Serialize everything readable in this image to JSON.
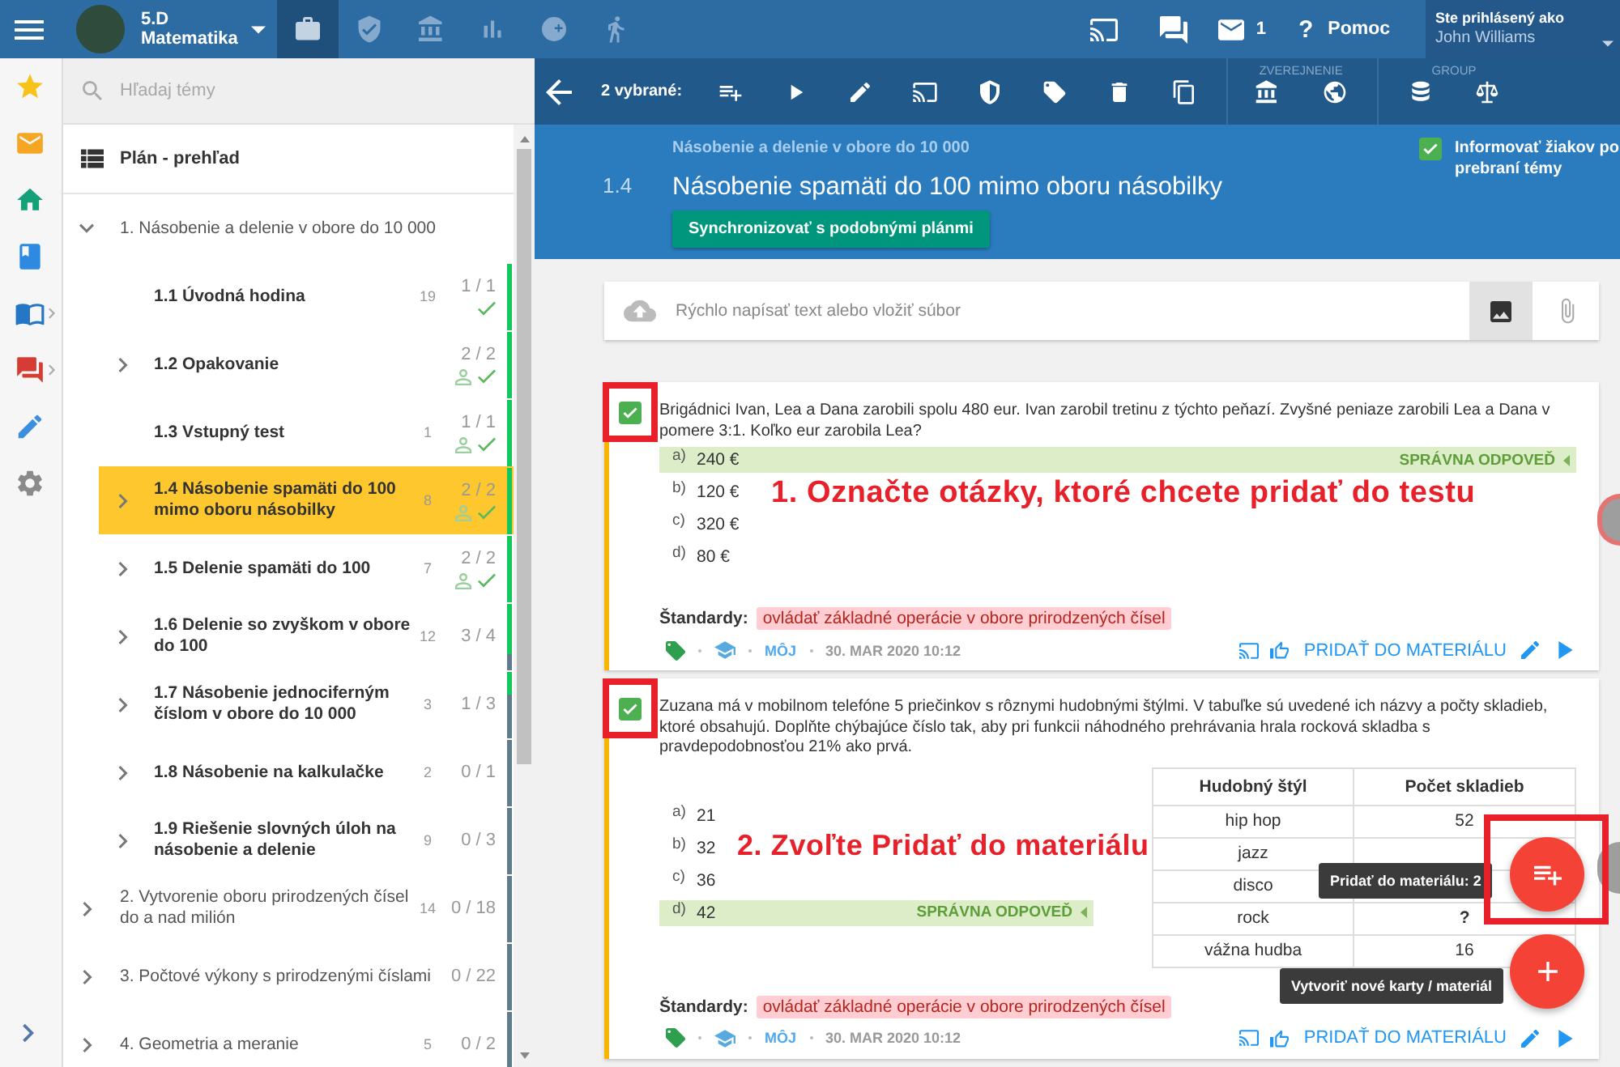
{
  "top_bar": {
    "class_name": "5.D",
    "subject": "Matematika",
    "nav_tabs": [
      {
        "selected": true
      },
      {
        "selected": false
      },
      {
        "selected": false
      },
      {
        "selected": false
      },
      {
        "selected": false
      },
      {
        "selected": false
      }
    ],
    "mail_count": "1",
    "help": {
      "icon": "?",
      "label": "Pomoc"
    },
    "user": {
      "label": "Ste prihlásený ako",
      "name": "John Williams"
    }
  },
  "sidebar": {
    "search": {
      "placeholder": "Hľadaj témy"
    },
    "overview": "Plán - prehľad",
    "chapters": [
      {
        "title": "1. Násobenie a delenie v obore do 10 000",
        "expanded": true,
        "selected": false,
        "children": [
          {
            "title": "1.1 Úvodná hodina",
            "expandable": false,
            "count": "19",
            "progress": "1 / 1",
            "shared": false,
            "done": true,
            "selected": false,
            "level": 1
          },
          {
            "title": "1.2 Opakovanie",
            "expandable": true,
            "progress": "2 / 2",
            "shared": true,
            "done": true,
            "selected": false,
            "level": 1
          },
          {
            "title": "1.3 Vstupný test",
            "expandable": false,
            "count": "1",
            "progress": "1 / 1",
            "shared": true,
            "done": true,
            "selected": false,
            "level": 1
          },
          {
            "title": "1.4 Násobenie spamäti do 100 mimo oboru násobilky",
            "expandable": true,
            "count": "8",
            "progress": "2 / 2",
            "shared": true,
            "done": true,
            "selected": true,
            "level": 1
          },
          {
            "title": "1.5 Delenie spamäti do 100",
            "expandable": true,
            "count": "7",
            "progress": "2 / 2",
            "shared": true,
            "done": true,
            "selected": false,
            "level": 1
          },
          {
            "title": "1.6 Delenie so zvyškom v obore do 100",
            "expandable": true,
            "count": "12",
            "progress": "3 / 4",
            "shared": false,
            "done": false,
            "selected": false,
            "level": 0.75
          },
          {
            "title": "1.7 Násobenie jednociferným číslom v obore do 10 000",
            "expandable": true,
            "count": "3",
            "progress": "1 / 3",
            "shared": false,
            "done": false,
            "selected": false,
            "level": 0.33
          },
          {
            "title": "1.8 Násobenie na kalkulačke",
            "expandable": true,
            "count": "2",
            "progress": "0 / 1",
            "shared": false,
            "done": false,
            "selected": false,
            "level": 0
          },
          {
            "title": "1.9 Riešenie slovných úloh na násobenie a delenie",
            "expandable": true,
            "count": "9",
            "progress": "0 / 3",
            "shared": false,
            "done": false,
            "selected": false,
            "level": 0
          }
        ]
      },
      {
        "title": "2. Vytvorenie oboru prirodzených čísel do a nad milión",
        "expanded": false,
        "selected": false,
        "count": "14",
        "progress": "0 / 18",
        "level": 0
      },
      {
        "title": "3. Počtové výkony s prirodzenými číslami",
        "expanded": false,
        "selected": false,
        "progress": "0 / 22",
        "level": 0
      },
      {
        "title": "4. Geometria a meranie",
        "expanded": false,
        "selected": false,
        "count": "5",
        "progress": "0 / 2",
        "level": 0
      }
    ]
  },
  "toolbar": {
    "selection": "2 vybrané:",
    "group_labels": [
      "ZVEREJNENIE",
      "GROUP"
    ]
  },
  "header": {
    "breadcrumb": "Násobenie a delenie v obore do 10 000",
    "number": "1.4",
    "title": "Násobenie spamäti do 100 mimo oboru násobilky",
    "sync_button": "Synchronizovať s podobnými plánmi",
    "notify": {
      "label": "Informovať žiakov po prebraní témy",
      "checked": true
    }
  },
  "composer": {
    "placeholder": "Rýchlo napísať text alebo vložiť súbor",
    "image_selected": true
  },
  "questions": [
    {
      "checked": true,
      "highlighted": true,
      "text": "Brigádnici Ivan, Lea a Dana zarobili spolu 480 eur. Ivan zarobil tretinu z týchto peňazí. Zvyšné peniaze zarobili Lea a Dana v pomere 3:1. Koľko eur zarobila Lea?",
      "options": [
        {
          "letter": "a)",
          "text": "240 €",
          "correct": true,
          "note": "SPRÁVNA ODPOVEĎ"
        },
        {
          "letter": "b)",
          "text": "120 €",
          "correct": false
        },
        {
          "letter": "c)",
          "text": "320 €",
          "correct": false
        },
        {
          "letter": "d)",
          "text": "80 €",
          "correct": false
        }
      ],
      "callout": "1. Označte otázky, ktoré chcete pridať do testu",
      "standards_label": "Štandardy:",
      "standards": [
        "ovládať základné operácie v obore prirodzených čísel"
      ],
      "author": "MÔJ",
      "date": "30. MAR 2020 10:12",
      "add_link": "PRIDAŤ DO MATERIÁLU"
    },
    {
      "checked": true,
      "highlighted": true,
      "text": "Zuzana má v mobilnom telefóne 5 priečinkov s rôznymi hudobnými štýlmi. V tabuľke sú uvedené ich názvy a počty skladieb, ktoré obsahujú. Doplňte chýbajúce číslo tak, aby pri funkcii náhodného prehrávania hrala rocková skladba s pravdepodobnosťou 21% ako prvá.",
      "table": {
        "columns": [
          "Hudobný štýl",
          "Počet skladieb"
        ],
        "rows": [
          {
            "cells": [
              "hip hop",
              "52"
            ],
            "unknown": false
          },
          {
            "cells": [
              "jazz"
            ]
          },
          {
            "cells": [
              "disco"
            ]
          },
          {
            "cells": [
              "rock",
              "?"
            ],
            "unknown": true
          },
          {
            "cells": [
              "vážna hudba",
              "16"
            ],
            "unknown": false
          }
        ]
      },
      "options": [
        {
          "letter": "a)",
          "text": "21",
          "correct": false
        },
        {
          "letter": "b)",
          "text": "32",
          "correct": false
        },
        {
          "letter": "c)",
          "text": "36",
          "correct": false
        },
        {
          "letter": "d)",
          "text": "42",
          "correct": true,
          "note": "SPRÁVNA ODPOVEĎ"
        }
      ],
      "callout": "2. Zvoľte Pridať do materiálu",
      "standards_label": "Štandardy:",
      "standards": [
        "ovládať základné operácie v obore prirodzených čísel"
      ],
      "author": "MÔJ",
      "date": "30. MAR 2020 10:12",
      "add_link": "PRIDAŤ DO MATERIÁLU"
    }
  ],
  "fabs": [
    {
      "kind": "add",
      "tooltip": "Pridať do materiálu: 2",
      "highlighted": true
    },
    {
      "kind": "create",
      "tooltip": "Vytvoriť nové karty / materiál",
      "highlighted": false
    }
  ]
}
